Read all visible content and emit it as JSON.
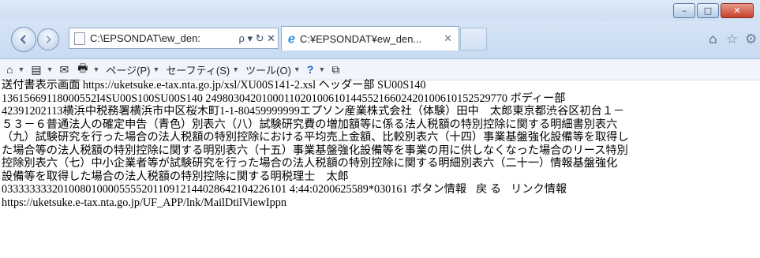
{
  "browser": {
    "address_url": "C:\\EPSONDAT\\ew_den:",
    "address_controls": "ρ ▾ ↻ ✕",
    "tab_title": "C:¥EPSONDAT¥ew_den...",
    "tab_close": "✕",
    "window_buttons": {
      "minimize": "–",
      "maximize": "□",
      "close": "✕"
    },
    "icons": {
      "back": "back-arrow-icon",
      "forward": "forward-arrow-icon",
      "home": "home-icon",
      "favorites": "star-icon",
      "settings": "gear-icon"
    }
  },
  "cmdbar": {
    "items": [
      {
        "icon": "⌂",
        "label": ""
      },
      {
        "icon": "▤",
        "label": ""
      },
      {
        "icon": "✉",
        "label": ""
      },
      {
        "icon": "🖶",
        "label": ""
      },
      {
        "icon": "",
        "label": "ページ(P)"
      },
      {
        "icon": "",
        "label": "セーフティ(S)"
      },
      {
        "icon": "",
        "label": "ツール(O)"
      },
      {
        "icon": "?",
        "label": ""
      },
      {
        "icon": "⧉",
        "label": ""
      }
    ]
  },
  "content": {
    "line1": "送付書表示画面 https://uketsuke.e-tax.nta.go.jp/xsl/XU00S141-2.xsl ヘッダー部 SU00S140",
    "line2": "13615669118000552I4SU00S100SU00S140 249803042010001102010061014455216602420100610152529770 ボディー部",
    "line3": "42391202113横浜中税務署横浜市中区桜木町1-1-80459999999エプソン産業株式会社（体験）田中　太郎東京都渋谷区初台１－",
    "line4": "５３－６普通法人の確定申告（青色）別表六（八）試験研究費の増加額等に係る法人税額の特別控除に関する明細書別表六",
    "line5": "（九）試験研究を行った場合の法人税額の特別控除における平均売上金額、比較別表六（十四）事業基盤強化設備等を取得し",
    "line6": "た場合等の法人税額の特別控除に関する明別表六（十五）事業基盤強化設備等を事業の用に供しなくなった場合のリース特別",
    "line7": "控除別表六（七）中小企業者等が試験研究を行った場合の法人税額の特別控除に関する明細別表六（二十一）情報基盤強化",
    "line8": "設備等を取得した場合の法人税額の特別控除に関する明税理士　太郎",
    "line9_code": "033333333201008010000555520110912144028642104226101 4:44:0200625589*030161",
    "line9_button_info": "ボタン情報",
    "line9_back": "戻 る",
    "line9_link_info": "リンク情報",
    "line10": "https://uketsuke.e-tax.nta.go.jp/UF_APP/lnk/MailDtilViewIppn"
  }
}
